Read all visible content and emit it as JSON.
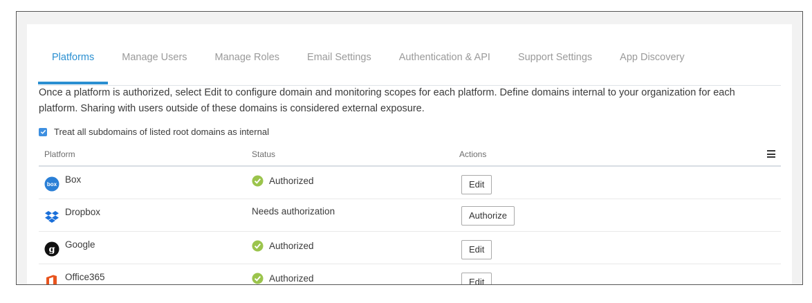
{
  "tabs": [
    {
      "label": "Platforms",
      "active": true
    },
    {
      "label": "Manage Users"
    },
    {
      "label": "Manage Roles"
    },
    {
      "label": "Email Settings"
    },
    {
      "label": "Authentication & API"
    },
    {
      "label": "Support Settings"
    },
    {
      "label": "App Discovery"
    }
  ],
  "description": "Once a platform is authorized, select Edit to configure domain and monitoring scopes for each platform. Define domains internal to your organization for each platform. Sharing with users outside of these domains is considered external exposure.",
  "subdomain_option": {
    "label": "Treat all subdomains of listed root domains as internal",
    "checked": true
  },
  "table": {
    "headers": {
      "platform": "Platform",
      "status": "Status",
      "actions": "Actions"
    },
    "rows": [
      {
        "platform": "Box",
        "status": "Authorized",
        "action": "Edit",
        "icon": "box-logo-icon"
      },
      {
        "platform": "Dropbox",
        "status": "Needs authorization",
        "action": "Authorize",
        "icon": "dropbox-logo-icon"
      },
      {
        "platform": "Google",
        "status": "Authorized",
        "action": "Edit",
        "icon": "google-logo-icon"
      },
      {
        "platform": "Office365",
        "status": "Authorized",
        "action": "Edit",
        "icon": "office365-logo-icon"
      }
    ]
  },
  "colors": {
    "accent": "#2a8fd1",
    "authorized": "#9bc44c",
    "checkbox": "#3d8fe0",
    "office": "#e8541e",
    "dropbox": "#1a6fd9",
    "box": "#2a7fd6"
  }
}
